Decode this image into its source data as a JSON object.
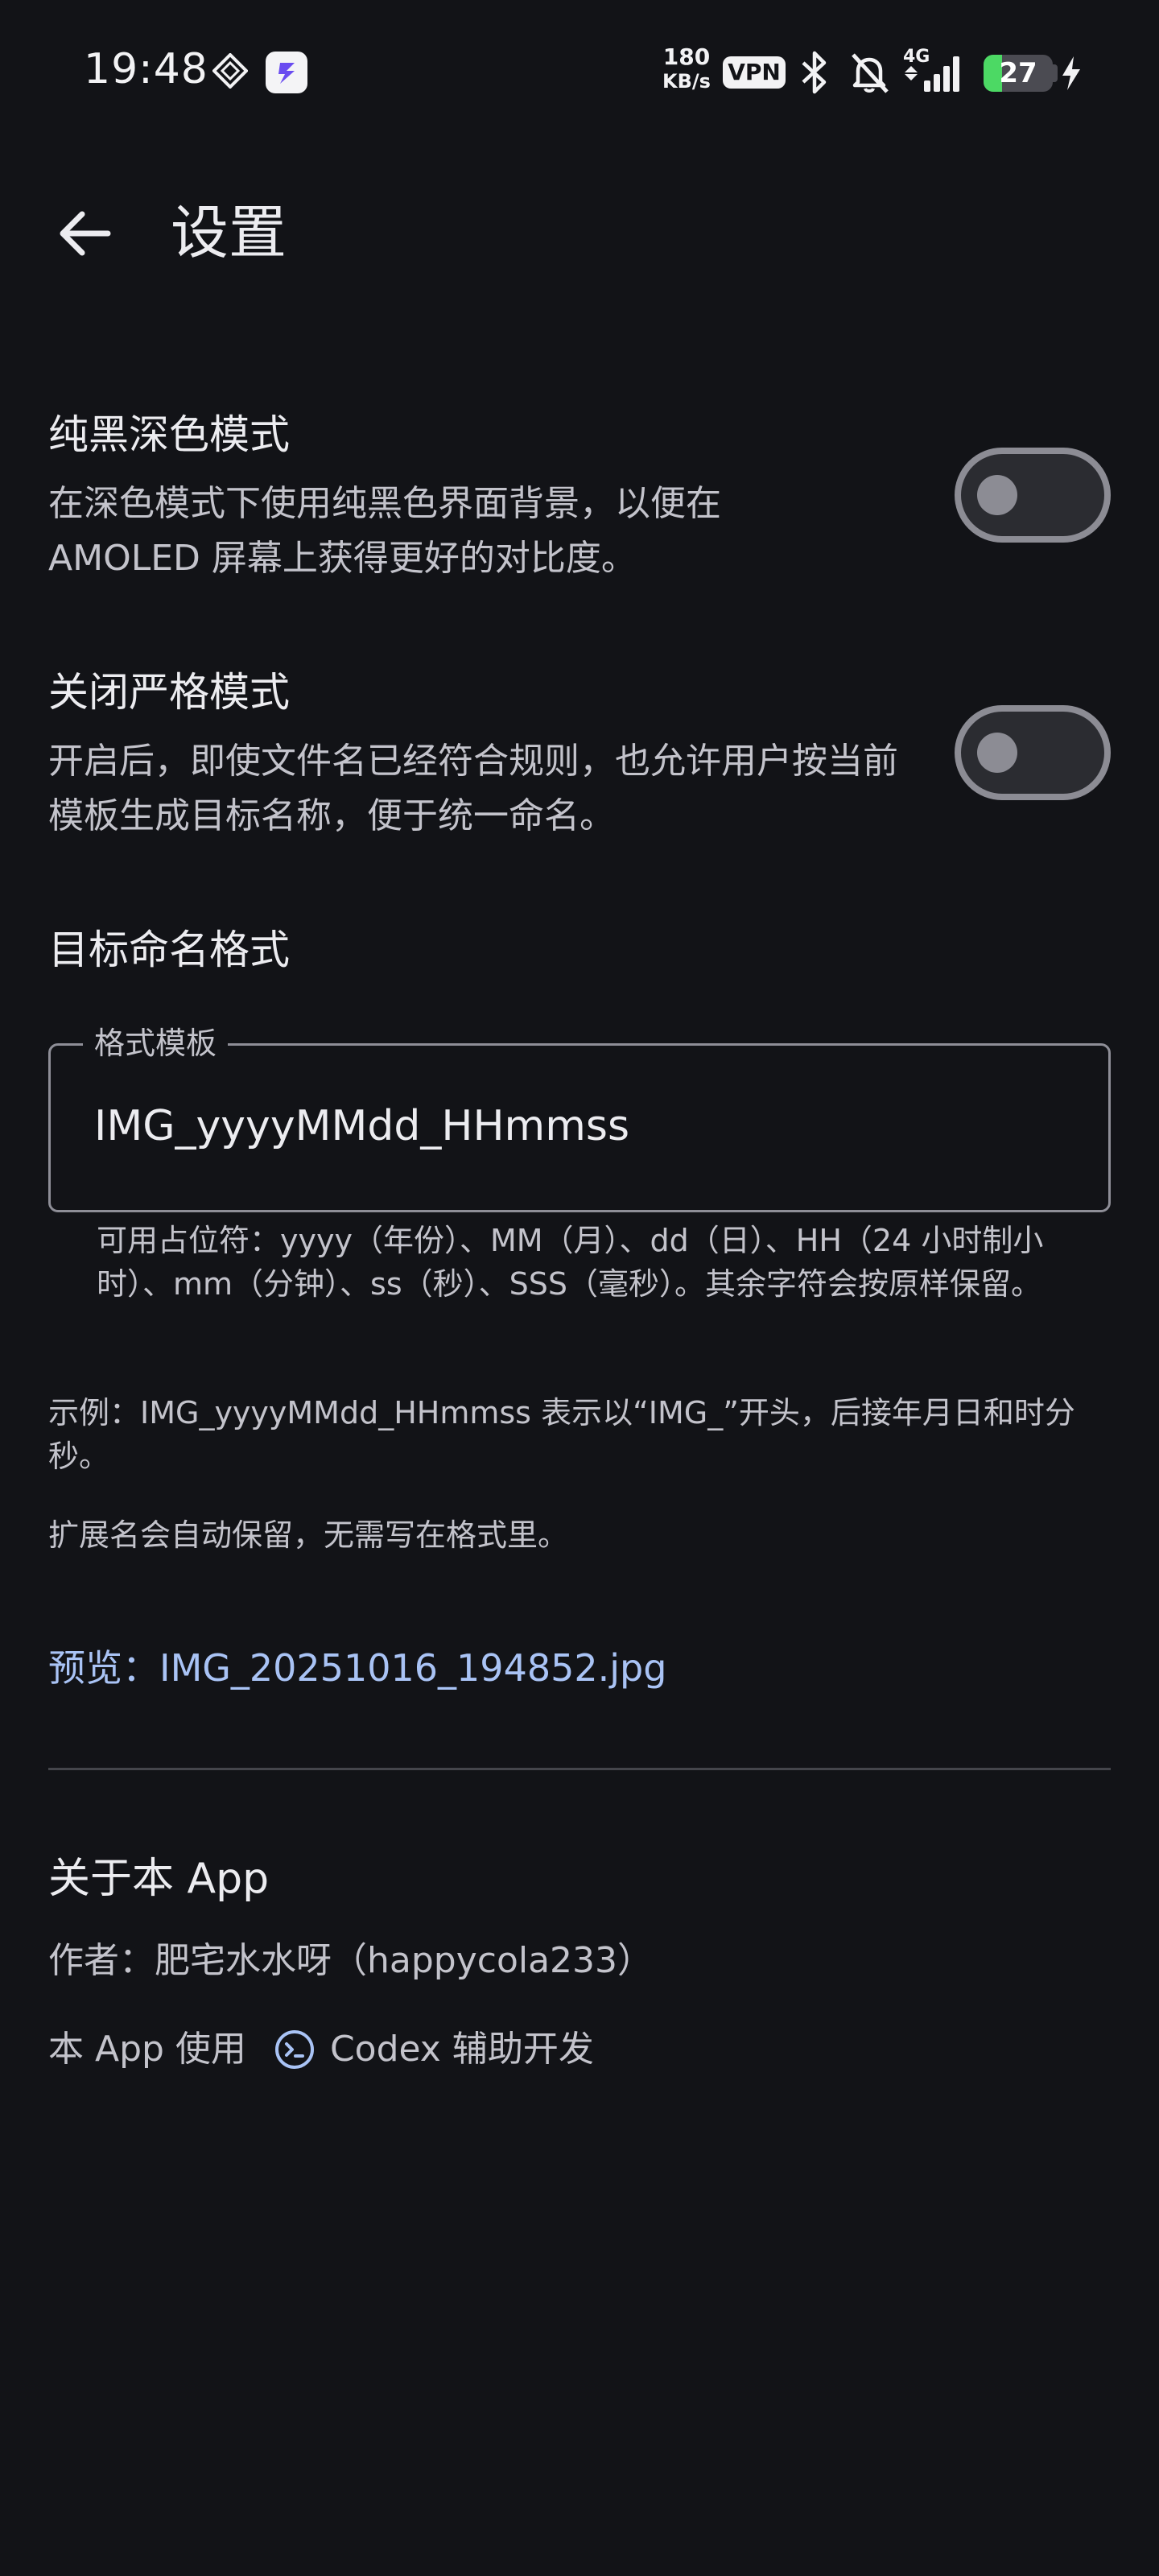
{
  "status_bar": {
    "time": "19:48",
    "net_speed_value": "180",
    "net_speed_unit": "KB/s",
    "vpn": "VPN",
    "network_type": "4G",
    "battery_level": "27",
    "battery_fraction": 0.27,
    "charging": true,
    "battery_color": "#4cd964"
  },
  "app_bar": {
    "back_icon": "arrow-left-icon",
    "title": "设置"
  },
  "settings": {
    "amoled": {
      "title": "纯黑深色模式",
      "description": "在深色模式下使用纯黑色界面背景，以便在AMOLED 屏幕上获得更好的对比度。",
      "enabled": false
    },
    "strict": {
      "title": "关闭严格模式",
      "description": "开启后，即使文件名已经符合规则，也允许用户按当前模板生成目标名称，便于统一命名。",
      "enabled": false
    }
  },
  "naming": {
    "section_title": "目标命名格式",
    "field_label": "格式模板",
    "field_value": "IMG_yyyyMMdd_HHmmss",
    "supporting_text": "可用占位符：yyyy（年份）、MM（月）、dd（日）、HH（24 小时制小时）、mm（分钟）、ss（秒）、SSS（毫秒）。其余字符会按原样保留。",
    "example_text": "示例：IMG_yyyyMMdd_HHmmss 表示以“IMG_”开头，后接年月日和时分秒。",
    "extension_note": "扩展名会自动保留，无需写在格式里。",
    "preview": "预览：IMG_20251016_194852.jpg"
  },
  "about": {
    "title": "关于本 App",
    "author": "作者：肥宅水水呀（happycola233）",
    "credit_prefix": "本 App 使用",
    "credit_icon": "codex-icon",
    "credit_suffix": "Codex 辅助开发"
  },
  "colors": {
    "background": "#121317",
    "accent_link": "#a9c3f5",
    "switch_outline": "#8c8c94"
  }
}
